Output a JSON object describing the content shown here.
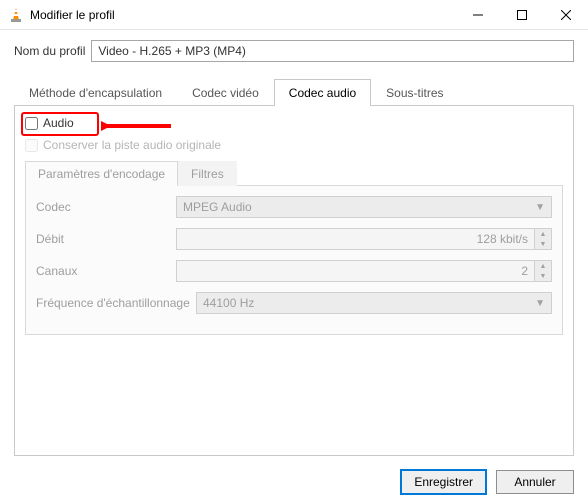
{
  "window": {
    "title": "Modifier le profil"
  },
  "profile": {
    "label": "Nom du profil",
    "value": "Video - H.265 + MP3 (MP4)"
  },
  "main_tabs": {
    "encapsulation": "Méthode d'encapsulation",
    "video_codec": "Codec vidéo",
    "audio_codec": "Codec audio",
    "subtitles": "Sous-titres"
  },
  "audio": {
    "enable_label": "Audio",
    "keep_original": "Conserver la piste audio originale"
  },
  "sub_tabs": {
    "encoding_params": "Paramètres d'encodage",
    "filters": "Filtres"
  },
  "fields": {
    "codec_label": "Codec",
    "codec_value": "MPEG Audio",
    "bitrate_label": "Débit",
    "bitrate_value": "128 kbit/s",
    "channels_label": "Canaux",
    "channels_value": "2",
    "samplerate_label": "Fréquence d'échantillonnage",
    "samplerate_value": "44100 Hz"
  },
  "buttons": {
    "save": "Enregistrer",
    "cancel": "Annuler"
  }
}
